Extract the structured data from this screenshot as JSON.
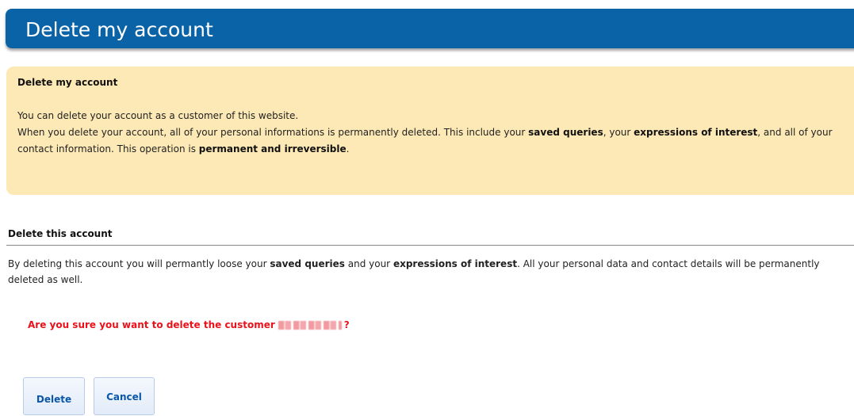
{
  "header": {
    "title": "Delete my account"
  },
  "info_box": {
    "heading": "Delete my account",
    "line1": "You can delete your account as a customer of this website.",
    "line2_a": "When you delete your account, all of your personal informations is permanently deleted. This include your ",
    "line2_b": "saved queries",
    "line2_c": ", your ",
    "line2_d": "expressions of interest",
    "line2_e": ", and all of your contact information. This operation is ",
    "line2_f": "permanent and irreversible",
    "line2_g": "."
  },
  "delete_section": {
    "title": "Delete this account",
    "text_a": "By deleting this account you will permantly loose your ",
    "text_b": "saved queries",
    "text_c": " and your ",
    "text_d": "expressions of interest",
    "text_e": ". All your personal data and contact details will be permanently deleted as well."
  },
  "confirm": {
    "prefix": "Are you sure you want to delete the customer",
    "suffix": "?"
  },
  "buttons": {
    "delete_label": "Delete",
    "cancel_label": "Cancel"
  },
  "colors": {
    "header_bg": "#0a63a6",
    "info_bg": "#fde9b5",
    "confirm_text": "#e8121a",
    "button_text": "#0a56a8"
  }
}
